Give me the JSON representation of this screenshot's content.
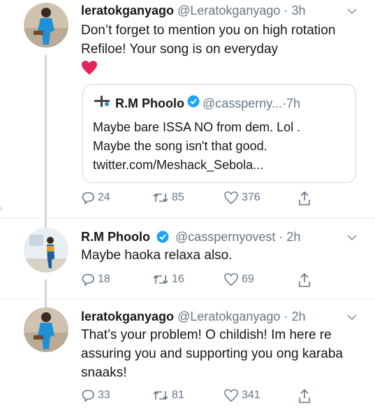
{
  "tweets": [
    {
      "name": "leratokganyago",
      "handle": "@Leratokganyago",
      "time": "3h",
      "text": "Don’t forget to mention you on high rotation Refiloe! Your song is on everyday",
      "emoji": "❤️",
      "quoted": {
        "name": "R.M Phoolo",
        "handle": "@cassperny...",
        "time": "7h",
        "text_lines": [
          "Maybe bare ISSA NO from dem. Lol .",
          "Maybe the song isn't that good.",
          "twitter.com/Meshack_Sebola..."
        ]
      },
      "replies": "24",
      "retweets": "85",
      "likes": "376"
    },
    {
      "name": "R.M Phoolo",
      "handle": "@cassperny­ovest",
      "time": "2h",
      "text": "Maybe haoka relaxa also.",
      "replies": "18",
      "retweets": "16",
      "likes": "69"
    },
    {
      "name": "leratokganyago",
      "handle": "@Leratokganyago",
      "time": "2h",
      "text": "That’s your problem! O childish! Im here re assuring you and supporting you ong karaba snaaks!",
      "replies": "33",
      "retweets": "81",
      "likes": "341"
    }
  ],
  "colors": {
    "name": "#14171a",
    "muted": "#657786",
    "verified": "#1da1f2",
    "thread": "#ccd6dd",
    "heart": "#e0245e"
  },
  "icons": [
    "reply-icon",
    "retweet-icon",
    "like-icon",
    "share-icon",
    "chevron-down-icon",
    "verified-icon"
  ]
}
